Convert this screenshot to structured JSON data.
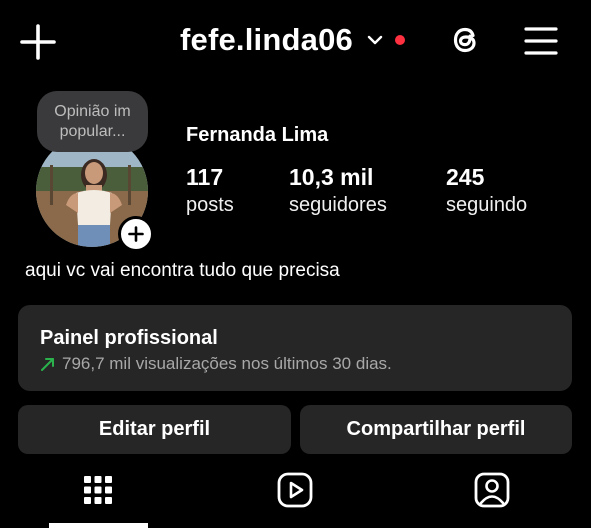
{
  "header": {
    "username": "fefe.linda06",
    "notification_dot_color": "#ff3040",
    "icons": [
      "plus-icon",
      "chevron-down-icon",
      "threads-icon",
      "hamburger-menu-icon"
    ]
  },
  "profile": {
    "note_bubble": "Opinião im popular...",
    "full_name": "Fernanda Lima",
    "stats": {
      "posts": {
        "value": "117",
        "label": "posts"
      },
      "followers": {
        "value": "10,3 mil",
        "label": "seguidores"
      },
      "following": {
        "value": "245",
        "label": "seguindo"
      }
    },
    "bio": "aqui vc vai encontra tudo que precisa"
  },
  "professional_panel": {
    "title": "Painel profissional",
    "stats_text": "796,7 mil visualizações nos últimos 30 dias.",
    "trend_color": "#2bb24c"
  },
  "actions": {
    "edit_label": "Editar perfil",
    "share_label": "Compartilhar perfil"
  },
  "tabs": [
    {
      "icon": "grid-icon",
      "active": true
    },
    {
      "icon": "reels-icon",
      "active": false
    },
    {
      "icon": "tagged-icon",
      "active": false
    }
  ]
}
